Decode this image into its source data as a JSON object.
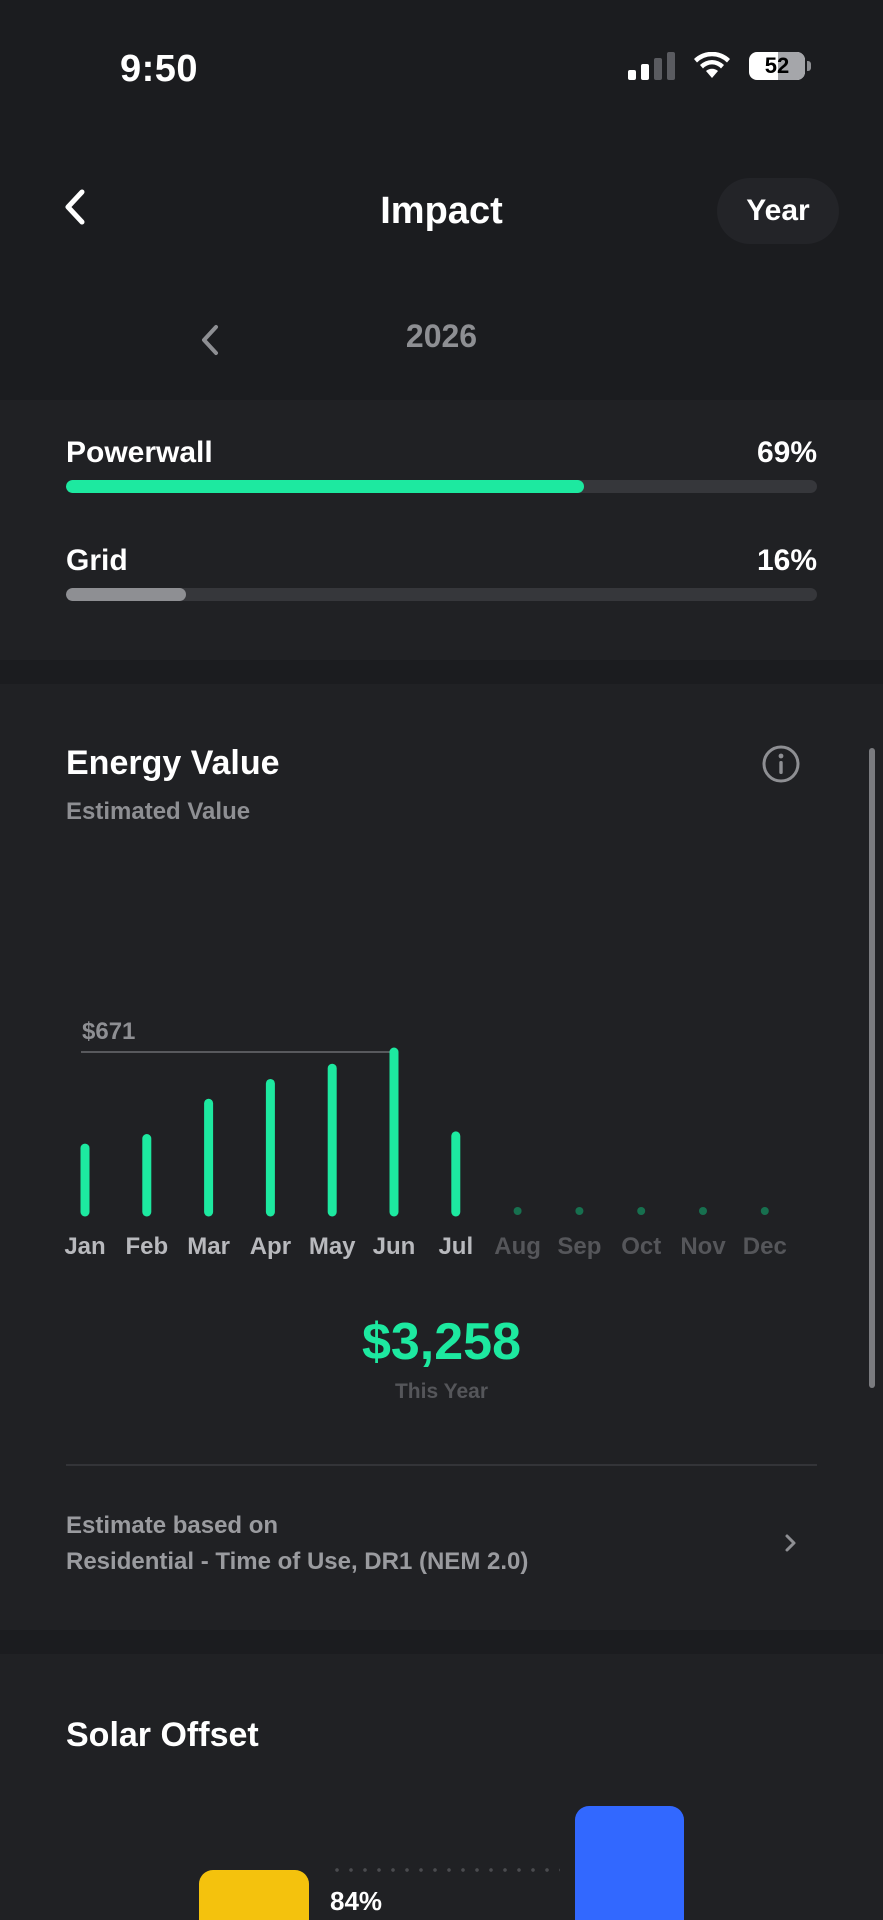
{
  "status_bar": {
    "time": "9:50",
    "battery": "52"
  },
  "nav": {
    "title": "Impact",
    "period_button": "Year"
  },
  "year_selector": {
    "year": "2026"
  },
  "sources": [
    {
      "label": "Powerwall",
      "value": "69%",
      "fraction": 0.69,
      "color": "#1de9a0"
    },
    {
      "label": "Grid",
      "value": "16%",
      "fraction": 0.16,
      "color": "#8e8f93"
    }
  ],
  "energy_value": {
    "title": "Energy Value",
    "subtitle": "Estimated Value",
    "total": "$3,258",
    "total_label": "This Year",
    "estimate_line1": "Estimate based on",
    "estimate_line2": "Residential - Time of Use, DR1 (NEM 2.0)"
  },
  "chart_data": {
    "type": "bar",
    "categories": [
      "Jan",
      "Feb",
      "Mar",
      "Apr",
      "May",
      "Jun",
      "Jul",
      "Aug",
      "Sep",
      "Oct",
      "Nov",
      "Dec"
    ],
    "values": [
      268,
      308,
      456,
      539,
      603,
      671,
      319,
      null,
      null,
      null,
      null,
      null
    ],
    "max_label": "$671",
    "max_value": 671,
    "bar_color": "#1de9a0",
    "future_color": "#17704f"
  },
  "solar_offset": {
    "title": "Solar Offset",
    "percent": "84%"
  }
}
